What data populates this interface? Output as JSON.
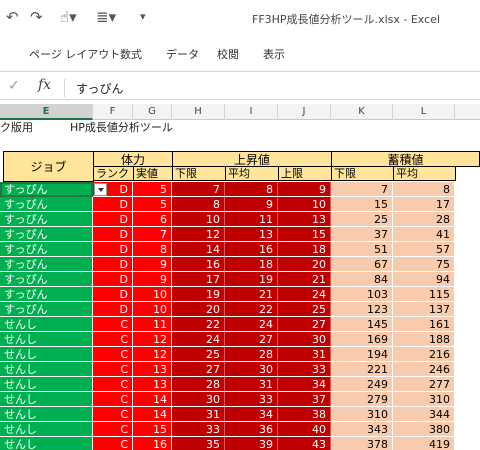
{
  "window": {
    "title": "FF3HP成長値分析ツール.xlsx - Excel"
  },
  "ribbon": {
    "tabs": [
      "ページ レイアウト",
      "数式",
      "データ",
      "校閲",
      "表示"
    ]
  },
  "formula_bar": {
    "value": "すっぴん"
  },
  "columns": [
    "E",
    "F",
    "G",
    "H",
    "I",
    "J",
    "K",
    "L"
  ],
  "selected_column": "E",
  "sheet": {
    "title_left": "ク版用",
    "title_main": "HP成長値分析ツール",
    "headers": {
      "job": "ジョブ",
      "group_tairyoku": "体力",
      "group_joushouchi": "上昇値",
      "group_chikuseki": "蓄積値",
      "rank": "ランク",
      "real": "実値",
      "lower": "下限",
      "avg": "平均",
      "upper": "上限"
    },
    "rows": [
      {
        "job": "すっぴん",
        "rank": "D",
        "real": "5",
        "up_lo": "7",
        "up_avg": "8",
        "up_hi": "9",
        "acc_lo": "7",
        "acc_avg": "8"
      },
      {
        "job": "すっぴん",
        "rank": "D",
        "real": "5",
        "up_lo": "8",
        "up_avg": "9",
        "up_hi": "10",
        "acc_lo": "15",
        "acc_avg": "17"
      },
      {
        "job": "すっぴん",
        "rank": "D",
        "real": "6",
        "up_lo": "10",
        "up_avg": "11",
        "up_hi": "13",
        "acc_lo": "25",
        "acc_avg": "28"
      },
      {
        "job": "すっぴん",
        "rank": "D",
        "real": "7",
        "up_lo": "12",
        "up_avg": "13",
        "up_hi": "15",
        "acc_lo": "37",
        "acc_avg": "41"
      },
      {
        "job": "すっぴん",
        "rank": "D",
        "real": "8",
        "up_lo": "14",
        "up_avg": "16",
        "up_hi": "18",
        "acc_lo": "51",
        "acc_avg": "57"
      },
      {
        "job": "すっぴん",
        "rank": "D",
        "real": "9",
        "up_lo": "16",
        "up_avg": "18",
        "up_hi": "20",
        "acc_lo": "67",
        "acc_avg": "75"
      },
      {
        "job": "すっぴん",
        "rank": "D",
        "real": "9",
        "up_lo": "17",
        "up_avg": "19",
        "up_hi": "21",
        "acc_lo": "84",
        "acc_avg": "94"
      },
      {
        "job": "すっぴん",
        "rank": "D",
        "real": "10",
        "up_lo": "19",
        "up_avg": "21",
        "up_hi": "24",
        "acc_lo": "103",
        "acc_avg": "115"
      },
      {
        "job": "すっぴん",
        "rank": "D",
        "real": "10",
        "up_lo": "20",
        "up_avg": "22",
        "up_hi": "25",
        "acc_lo": "123",
        "acc_avg": "137"
      },
      {
        "job": "せんし",
        "rank": "C",
        "real": "11",
        "up_lo": "22",
        "up_avg": "24",
        "up_hi": "27",
        "acc_lo": "145",
        "acc_avg": "161"
      },
      {
        "job": "せんし",
        "rank": "C",
        "real": "12",
        "up_lo": "24",
        "up_avg": "27",
        "up_hi": "30",
        "acc_lo": "169",
        "acc_avg": "188"
      },
      {
        "job": "せんし",
        "rank": "C",
        "real": "12",
        "up_lo": "25",
        "up_avg": "28",
        "up_hi": "31",
        "acc_lo": "194",
        "acc_avg": "216"
      },
      {
        "job": "せんし",
        "rank": "C",
        "real": "13",
        "up_lo": "27",
        "up_avg": "30",
        "up_hi": "33",
        "acc_lo": "221",
        "acc_avg": "246"
      },
      {
        "job": "せんし",
        "rank": "C",
        "real": "13",
        "up_lo": "28",
        "up_avg": "31",
        "up_hi": "34",
        "acc_lo": "249",
        "acc_avg": "277"
      },
      {
        "job": "せんし",
        "rank": "C",
        "real": "14",
        "up_lo": "30",
        "up_avg": "33",
        "up_hi": "37",
        "acc_lo": "279",
        "acc_avg": "310"
      },
      {
        "job": "せんし",
        "rank": "C",
        "real": "14",
        "up_lo": "31",
        "up_avg": "34",
        "up_hi": "38",
        "acc_lo": "310",
        "acc_avg": "344"
      },
      {
        "job": "せんし",
        "rank": "C",
        "real": "15",
        "up_lo": "33",
        "up_avg": "36",
        "up_hi": "40",
        "acc_lo": "343",
        "acc_avg": "380"
      },
      {
        "job": "せんし",
        "rank": "C",
        "real": "16",
        "up_lo": "35",
        "up_avg": "39",
        "up_hi": "43",
        "acc_lo": "378",
        "acc_avg": "419"
      }
    ]
  }
}
